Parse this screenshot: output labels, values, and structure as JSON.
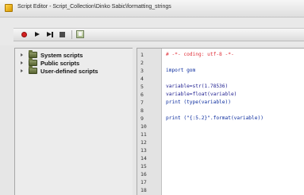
{
  "window": {
    "title": "Script Editor - Script_Collection\\Dinko Sabic\\formatting_strings"
  },
  "toolbar": {
    "buttons": [
      {
        "name": "record-button",
        "icon": "record-icon"
      },
      {
        "name": "run-button",
        "icon": "play-icon"
      },
      {
        "name": "run-step-button",
        "icon": "step-play-icon"
      },
      {
        "name": "stop-button",
        "icon": "stop-icon"
      },
      {
        "name": "script-options-button",
        "icon": "document-icon"
      }
    ]
  },
  "tree": {
    "items": [
      {
        "label": "System scripts",
        "icon": "folder-icon"
      },
      {
        "label": "Public scripts",
        "icon": "folder-icon"
      },
      {
        "label": "User-defined scripts",
        "icon": "folder-icon"
      }
    ]
  },
  "editor": {
    "line_numbers": [
      "1",
      "2",
      "3",
      "4",
      "5",
      "6",
      "7",
      "8",
      "9",
      "10",
      "11",
      "12",
      "13",
      "14",
      "15",
      "16",
      "17",
      "18"
    ],
    "lines": [
      "# -*- coding: utf-8 -*-",
      "",
      "import gom",
      "",
      "variable=str(1.78536)",
      "variable=float(variable)",
      "print (type(variable))",
      "",
      "print (\"{:5.2}\".format(variable))",
      "",
      "",
      "",
      "",
      "",
      "",
      "",
      "",
      ""
    ]
  },
  "colors": {
    "comment": "#e0313a",
    "keyword": "#0b2c9e",
    "code_text": "#1d1d8f",
    "record_red": "#d42020"
  }
}
